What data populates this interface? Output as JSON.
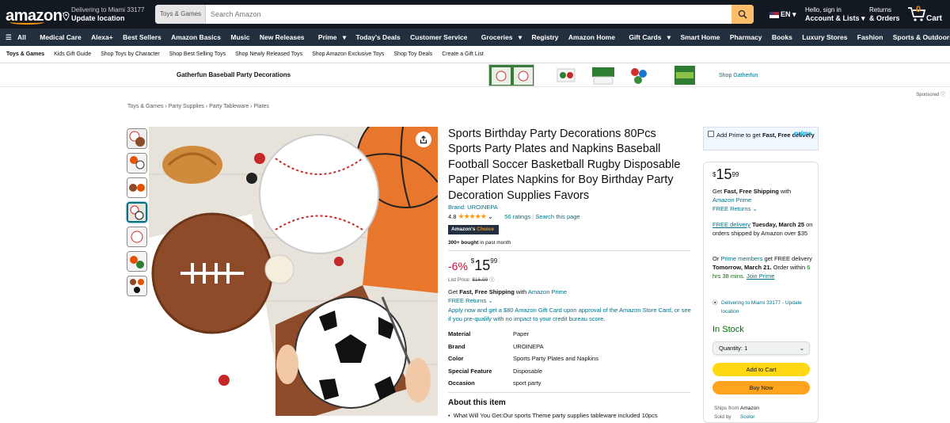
{
  "header": {
    "logo": "amazon",
    "deliver_line1": "Delivering to Miami 33177",
    "deliver_line2": "Update location",
    "search_category": "Toys & Games",
    "search_placeholder": "Search Amazon",
    "lang": "EN",
    "account_line1": "Hello, sign in",
    "account_line2": "Account & Lists",
    "returns_line1": "Returns",
    "returns_line2": "& Orders",
    "cart_count": "0",
    "cart_label": "Cart"
  },
  "nav": {
    "all": "All",
    "items": [
      "Medical Care",
      "Alexa+",
      "Best Sellers",
      "Amazon Basics",
      "Music",
      "New Releases",
      "Prime",
      "Today's Deals",
      "Customer Service",
      "Groceries",
      "Registry",
      "Amazon Home",
      "Gift Cards",
      "Smart Home",
      "Pharmacy",
      "Books",
      "Luxury Stores",
      "Fashion",
      "Sports & Outdoors"
    ]
  },
  "subnav": {
    "items": [
      "Toys & Games",
      "Kids Gift Guide",
      "Shop Toys by Character",
      "Shop Best Selling Toys",
      "Shop Newly Released Toys",
      "Shop Amazon Exclusive Toys",
      "Shop Toy Deals",
      "Create a Gift List"
    ]
  },
  "banner": {
    "title": "Gatherfun Baseball Party Decorations",
    "link": "Shop Gatherfun",
    "sponsored": "Sponsored"
  },
  "breadcrumb": [
    "Toys & Games",
    "Party Supplies",
    "Party Tableware",
    "Plates"
  ],
  "product": {
    "title": "Sports Birthday Party Decorations 80Pcs Sports Party Plates and Napkins Baseball Football Soccer Basketball Rugby Disposable Paper Plates Napkins for Boy Birthday Party Decoration Supplies Favors",
    "brand": "Brand: UROINEPA",
    "rating": "4.8",
    "ratings_count": "56 ratings",
    "search_page": "Search this page",
    "choice_a": "Amazon's",
    "choice_b": "Choice",
    "bought_bold": "300+ bought",
    "bought_rest": " in past month",
    "discount": "-6%",
    "price_whole": "15",
    "price_frac": "99",
    "list_label": "List Price: ",
    "list_price": "$16.99",
    "fast_pre": "Get ",
    "fast_bold": "Fast, Free Shipping",
    "fast_mid": " with ",
    "fast_link": "Amazon Prime",
    "free_returns": "FREE Returns",
    "apply_text": "Apply now and get a $80 Amazon Gift Card upon approval of the Amazon Store Card, or see if you pre-qualify with no impact to your credit bureau score.",
    "specs": [
      {
        "k": "Material",
        "v": "Paper"
      },
      {
        "k": "Brand",
        "v": "UROINEPA"
      },
      {
        "k": "Color",
        "v": "Sports Party Plates and Napkins"
      },
      {
        "k": "Special Feature",
        "v": "Disposable"
      },
      {
        "k": "Occasion",
        "v": "sport party"
      }
    ],
    "about_title": "About this item",
    "bullet1": "What Will You Get:Our sports Theme party supplies tableware included 10pcs"
  },
  "prime_box": {
    "text_a": "Add Prime to get ",
    "text_b": "Fast, Free delivery",
    "logo": "prime"
  },
  "buybox": {
    "price_whole": "15",
    "price_frac": "99",
    "fast_pre": "Get ",
    "fast_bold": "Fast, Free Shipping",
    "fast_mid": " with ",
    "fast_link": "Amazon Prime",
    "free_returns": "FREE Returns",
    "free_delivery": "FREE delivery",
    "delivery_date": "Tuesday, March 25",
    "delivery_rest": " on orders shipped by Amazon over $35",
    "or": "Or ",
    "prime_members": "Prime members",
    "fastest_mid": " get FREE delivery ",
    "fastest_date": "Tomorrow, March 21.",
    "order_within": " Order within ",
    "countdown": "6 hrs 38 mins.",
    "join_prime": "Join Prime",
    "location": "Delivering to Miami 33177 - Update location",
    "in_stock": "In Stock",
    "quantity": "Quantity: 1",
    "add_to_cart": "Add to Cart",
    "buy_now": "Buy Now",
    "ships_from_k": "Ships from",
    "ships_from_v": "Amazon",
    "sold_by_k": "Sold by",
    "sold_by_v": "Scolor"
  },
  "colors": {
    "nav_dark": "#131921",
    "nav_mid": "#232f3e",
    "accent": "#ff9900",
    "link": "#007185",
    "price_red": "#cc0c39",
    "in_stock": "#007600",
    "cart_btn": "#ffd814",
    "buy_btn": "#ffa41c"
  }
}
